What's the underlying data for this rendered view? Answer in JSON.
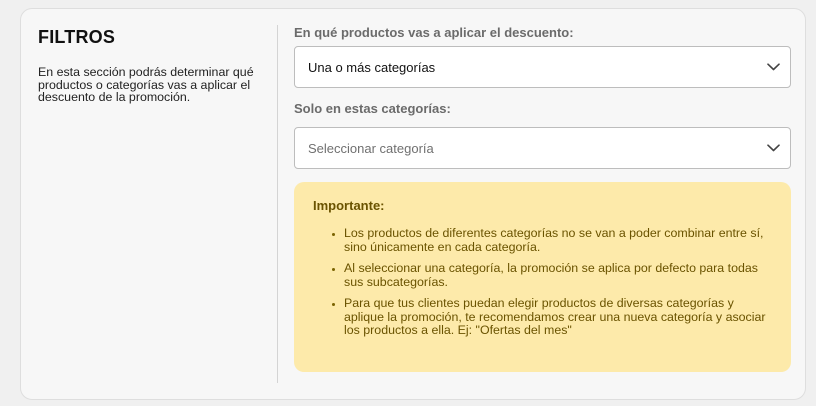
{
  "section": {
    "title": "FILTROS",
    "description": "En esta sección podrás determinar qué productos o categorías vas a aplicar el descuento de la promoción."
  },
  "products_field": {
    "label": "En qué productos vas a aplicar el descuento:",
    "selected": "Una o más categorías"
  },
  "categories_field": {
    "label": "Solo en estas categorías:",
    "placeholder": "Seleccionar categoría"
  },
  "notice": {
    "title": "Importante:",
    "items": [
      "Los productos de diferentes categorías no se van a poder combinar entre sí, sino únicamente en cada categoría.",
      "Al seleccionar una categoría, la promoción se aplica por defecto para todas sus subcategorías.",
      "Para que tus clientes puedan elegir productos de diversas categorías y aplique la promoción, te recomendamos crear una nueva categoría y asociar los productos a ella. Ej: \"Ofertas del mes\""
    ]
  },
  "icons": {
    "dropdown": "chevron-down-icon"
  },
  "colors": {
    "notice_background": "#fdeaaa",
    "notice_text": "#6a5300",
    "border": "#bdbdbd"
  }
}
